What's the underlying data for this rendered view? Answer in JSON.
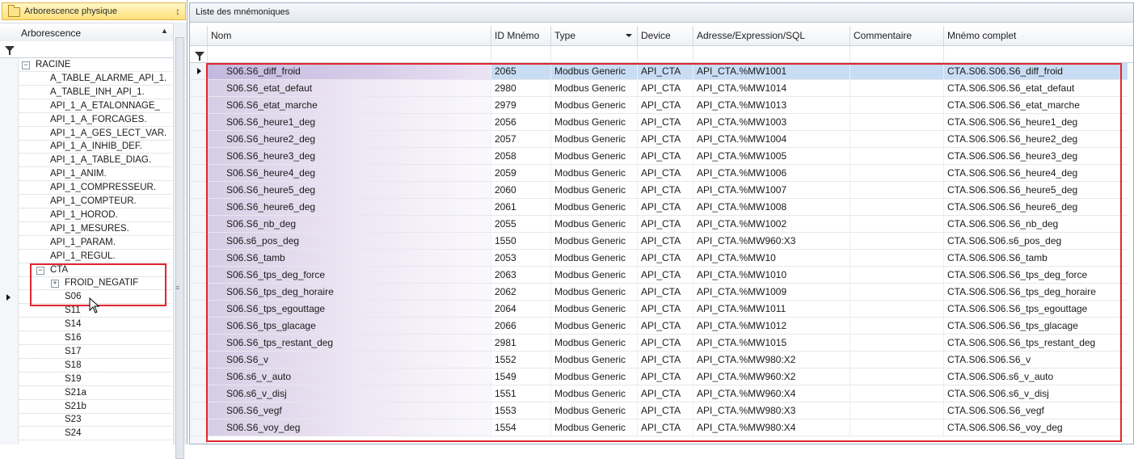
{
  "left_panel": {
    "title": "Arborescence physique",
    "column_header": "Arborescence",
    "root": "RACINE",
    "items": [
      "A_TABLE_ALARME_API_1.",
      "A_TABLE_INH_API_1.",
      "API_1_A_ETALONNAGE_",
      "API_1_A_FORCAGES.",
      "API_1_A_GES_LECT_VAR.",
      "API_1_A_INHIB_DEF.",
      "API_1_A_TABLE_DIAG.",
      "API_1_ANIM.",
      "API_1_COMPRESSEUR.",
      "API_1_COMPTEUR.",
      "API_1_HOROD.",
      "API_1_MESURES.",
      "API_1_PARAM.",
      "API_1_REGUL."
    ],
    "cta": "CTA",
    "cta_children_group": "FROID_NEGATIF",
    "cta_children": [
      "S06",
      "S11",
      "S14",
      "S16",
      "S17",
      "S18",
      "S19",
      "S21a",
      "S21b",
      "S23",
      "S24"
    ],
    "selected": "S06"
  },
  "right_panel": {
    "title": "Liste des mnémoniques",
    "columns": [
      "Nom",
      "ID Mnémo",
      "Type",
      "Device",
      "Adresse/Expression/SQL",
      "Commentaire",
      "Mnémo complet"
    ],
    "rows": [
      {
        "nom": "S06.S6_diff_froid",
        "id": "2065",
        "type": "Modbus Generic",
        "device": "API_CTA",
        "adresse": "API_CTA.%MW1001",
        "commentaire": "",
        "complet": "CTA.S06.S06.S6_diff_froid"
      },
      {
        "nom": "S06.S6_etat_defaut",
        "id": "2980",
        "type": "Modbus Generic",
        "device": "API_CTA",
        "adresse": "API_CTA.%MW1014",
        "commentaire": "",
        "complet": "CTA.S06.S06.S6_etat_defaut"
      },
      {
        "nom": "S06.S6_etat_marche",
        "id": "2979",
        "type": "Modbus Generic",
        "device": "API_CTA",
        "adresse": "API_CTA.%MW1013",
        "commentaire": "",
        "complet": "CTA.S06.S06.S6_etat_marche"
      },
      {
        "nom": "S06.S6_heure1_deg",
        "id": "2056",
        "type": "Modbus Generic",
        "device": "API_CTA",
        "adresse": "API_CTA.%MW1003",
        "commentaire": "",
        "complet": "CTA.S06.S06.S6_heure1_deg"
      },
      {
        "nom": "S06.S6_heure2_deg",
        "id": "2057",
        "type": "Modbus Generic",
        "device": "API_CTA",
        "adresse": "API_CTA.%MW1004",
        "commentaire": "",
        "complet": "CTA.S06.S06.S6_heure2_deg"
      },
      {
        "nom": "S06.S6_heure3_deg",
        "id": "2058",
        "type": "Modbus Generic",
        "device": "API_CTA",
        "adresse": "API_CTA.%MW1005",
        "commentaire": "",
        "complet": "CTA.S06.S06.S6_heure3_deg"
      },
      {
        "nom": "S06.S6_heure4_deg",
        "id": "2059",
        "type": "Modbus Generic",
        "device": "API_CTA",
        "adresse": "API_CTA.%MW1006",
        "commentaire": "",
        "complet": "CTA.S06.S06.S6_heure4_deg"
      },
      {
        "nom": "S06.S6_heure5_deg",
        "id": "2060",
        "type": "Modbus Generic",
        "device": "API_CTA",
        "adresse": "API_CTA.%MW1007",
        "commentaire": "",
        "complet": "CTA.S06.S06.S6_heure5_deg"
      },
      {
        "nom": "S06.S6_heure6_deg",
        "id": "2061",
        "type": "Modbus Generic",
        "device": "API_CTA",
        "adresse": "API_CTA.%MW1008",
        "commentaire": "",
        "complet": "CTA.S06.S06.S6_heure6_deg"
      },
      {
        "nom": "S06.S6_nb_deg",
        "id": "2055",
        "type": "Modbus Generic",
        "device": "API_CTA",
        "adresse": "API_CTA.%MW1002",
        "commentaire": "",
        "complet": "CTA.S06.S06.S6_nb_deg"
      },
      {
        "nom": "S06.s6_pos_deg",
        "id": "1550",
        "type": "Modbus Generic",
        "device": "API_CTA",
        "adresse": "API_CTA.%MW960:X3",
        "commentaire": "",
        "complet": "CTA.S06.S06.s6_pos_deg"
      },
      {
        "nom": "S06.S6_tamb",
        "id": "2053",
        "type": "Modbus Generic",
        "device": "API_CTA",
        "adresse": "API_CTA.%MW10",
        "commentaire": "",
        "complet": "CTA.S06.S06.S6_tamb"
      },
      {
        "nom": "S06.S6_tps_deg_force",
        "id": "2063",
        "type": "Modbus Generic",
        "device": "API_CTA",
        "adresse": "API_CTA.%MW1010",
        "commentaire": "",
        "complet": "CTA.S06.S06.S6_tps_deg_force"
      },
      {
        "nom": "S06.S6_tps_deg_horaire",
        "id": "2062",
        "type": "Modbus Generic",
        "device": "API_CTA",
        "adresse": "API_CTA.%MW1009",
        "commentaire": "",
        "complet": "CTA.S06.S06.S6_tps_deg_horaire"
      },
      {
        "nom": "S06.S6_tps_egouttage",
        "id": "2064",
        "type": "Modbus Generic",
        "device": "API_CTA",
        "adresse": "API_CTA.%MW1011",
        "commentaire": "",
        "complet": "CTA.S06.S06.S6_tps_egouttage"
      },
      {
        "nom": "S06.S6_tps_glacage",
        "id": "2066",
        "type": "Modbus Generic",
        "device": "API_CTA",
        "adresse": "API_CTA.%MW1012",
        "commentaire": "",
        "complet": "CTA.S06.S06.S6_tps_glacage"
      },
      {
        "nom": "S06.S6_tps_restant_deg",
        "id": "2981",
        "type": "Modbus Generic",
        "device": "API_CTA",
        "adresse": "API_CTA.%MW1015",
        "commentaire": "",
        "complet": "CTA.S06.S06.S6_tps_restant_deg"
      },
      {
        "nom": "S06.S6_v",
        "id": "1552",
        "type": "Modbus Generic",
        "device": "API_CTA",
        "adresse": "API_CTA.%MW980:X2",
        "commentaire": "",
        "complet": "CTA.S06.S06.S6_v"
      },
      {
        "nom": "S06.s6_v_auto",
        "id": "1549",
        "type": "Modbus Generic",
        "device": "API_CTA",
        "adresse": "API_CTA.%MW960:X2",
        "commentaire": "",
        "complet": "CTA.S06.S06.s6_v_auto"
      },
      {
        "nom": "S06.s6_v_disj",
        "id": "1551",
        "type": "Modbus Generic",
        "device": "API_CTA",
        "adresse": "API_CTA.%MW960:X4",
        "commentaire": "",
        "complet": "CTA.S06.S06.s6_v_disj"
      },
      {
        "nom": "S06.S6_vegf",
        "id": "1553",
        "type": "Modbus Generic",
        "device": "API_CTA",
        "adresse": "API_CTA.%MW980:X3",
        "commentaire": "",
        "complet": "CTA.S06.S06.S6_vegf"
      },
      {
        "nom": "S06.S6_voy_deg",
        "id": "1554",
        "type": "Modbus Generic",
        "device": "API_CTA",
        "adresse": "API_CTA.%MW980:X4",
        "commentaire": "",
        "complet": "CTA.S06.S06.S6_voy_deg"
      }
    ],
    "selected_row": 0
  },
  "icons": {
    "panel_icon": "folder-icon",
    "pin": "pin-icon",
    "filter": "filter-icon",
    "expand": "plus-icon",
    "collapse": "minus-icon",
    "row_indicator": "row-arrow-icon",
    "cursor": "mouse-cursor-icon"
  },
  "colors": {
    "highlight_box": "#e2262d",
    "selected_row": "#c8dcf3",
    "nom_column_tint": "#d6cde4",
    "title_bar_active": "#ffe17a"
  }
}
